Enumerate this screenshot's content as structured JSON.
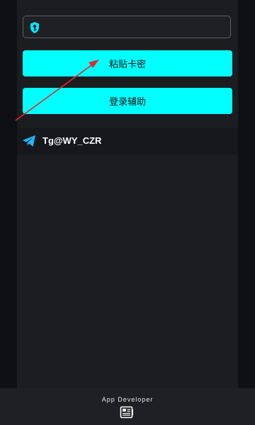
{
  "key_input": {
    "value": "",
    "placeholder": ""
  },
  "buttons": {
    "paste_label": "粘贴卡密",
    "login_label": "登录辅助"
  },
  "telegram": {
    "label": "Tg@WY_CZR",
    "icon": "telegram-plane-icon"
  },
  "footer": {
    "label": "App Developer",
    "icon": "developer-card-icon"
  },
  "colors": {
    "background": "#0f1013",
    "panel": "#1c1d21",
    "accent": "#00ffff",
    "arrow": "#e32b2b",
    "telegram_blue": "#22b7ff"
  },
  "annotation_arrow": {
    "color": "#e32b2b"
  }
}
